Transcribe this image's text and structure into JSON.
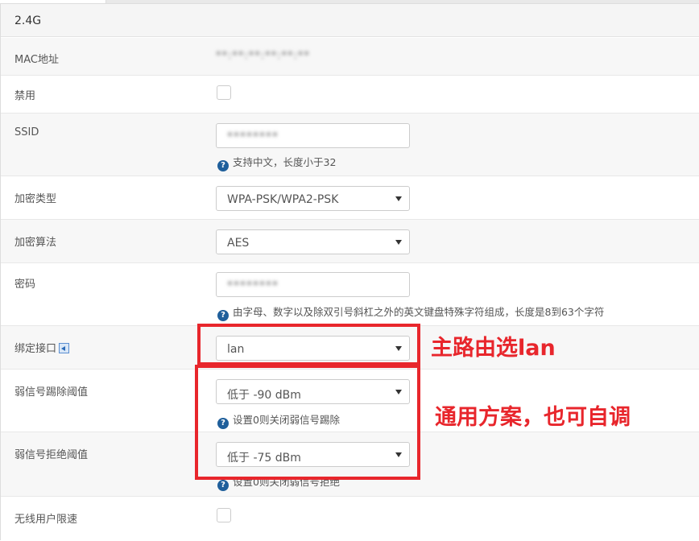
{
  "panel": {
    "title": "2.4G"
  },
  "fields": {
    "mac": {
      "label": "MAC地址",
      "value": "**:**:**:**:**:**"
    },
    "disable": {
      "label": "禁用"
    },
    "ssid": {
      "label": "SSID",
      "value": "********",
      "help": "支持中文，长度小于32"
    },
    "encryption": {
      "label": "加密类型",
      "value": "WPA-PSK/WPA2-PSK"
    },
    "cipher": {
      "label": "加密算法",
      "value": "AES"
    },
    "password": {
      "label": "密码",
      "value": "********",
      "help": "由字母、数字以及除双引号斜杠之外的英文键盘特殊字符组成，长度是8到63个字符"
    },
    "interface": {
      "label": "绑定接口",
      "value": "lan"
    },
    "kick_threshold": {
      "label": "弱信号踢除阈值",
      "value": "低于 -90 dBm",
      "help": "设置0则关闭弱信号踢除"
    },
    "reject_threshold": {
      "label": "弱信号拒绝阈值",
      "value": "低于 -75 dBm",
      "help": "设置0则关闭弱信号拒绝"
    },
    "rate_limit": {
      "label": "无线用户限速"
    }
  },
  "annotations": {
    "interface_note": "主路由选lan",
    "threshold_note": "通用方案，也可自调"
  },
  "colors": {
    "annotation": "#e8262c",
    "help_icon": "#1f5f9b"
  },
  "icons": {
    "help": "question-circle-icon",
    "interface_link": "link-arrow-icon"
  }
}
